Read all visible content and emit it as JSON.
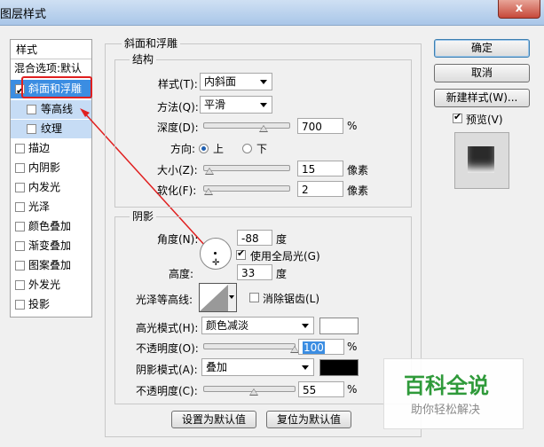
{
  "window": {
    "title": "图层样式",
    "close": "x"
  },
  "left_panel": {
    "header": "样式",
    "blend_options": "混合选项:默认",
    "items": [
      {
        "label": "斜面和浮雕",
        "checked": true,
        "selected": true
      },
      {
        "label": "等高线",
        "checked": false,
        "sub": true
      },
      {
        "label": "纹理",
        "checked": false,
        "sub": true
      },
      {
        "label": "描边",
        "checked": false
      },
      {
        "label": "内阴影",
        "checked": false
      },
      {
        "label": "内发光",
        "checked": false
      },
      {
        "label": "光泽",
        "checked": false
      },
      {
        "label": "颜色叠加",
        "checked": false
      },
      {
        "label": "渐变叠加",
        "checked": false
      },
      {
        "label": "图案叠加",
        "checked": false
      },
      {
        "label": "外发光",
        "checked": false
      },
      {
        "label": "投影",
        "checked": false
      }
    ]
  },
  "bevel": {
    "group_title": "斜面和浮雕",
    "structure_title": "结构",
    "style_label": "样式(T):",
    "style_value": "内斜面",
    "technique_label": "方法(Q):",
    "technique_value": "平滑",
    "depth_label": "深度(D):",
    "depth_value": "700",
    "depth_unit": "%",
    "depth_pct": 0.7,
    "direction_label": "方向:",
    "dir_up": "上",
    "dir_down": "下",
    "size_label": "大小(Z):",
    "size_value": "15",
    "size_unit": "像素",
    "size_pct": 0.06,
    "soften_label": "软化(F):",
    "soften_value": "2",
    "soften_unit": "像素",
    "soften_pct": 0.05
  },
  "shading": {
    "title": "阴影",
    "angle_label": "角度(N):",
    "angle_value": "-88",
    "angle_unit": "度",
    "global_light_label": "使用全局光(G)",
    "altitude_label": "高度:",
    "altitude_value": "33",
    "altitude_unit": "度",
    "gloss_label": "光泽等高线:",
    "antialias_label": "消除锯齿(L)",
    "highlight_label": "高光模式(H):",
    "highlight_value": "颜色减淡",
    "highlight_color": "#ffffff",
    "hl_opacity_label": "不透明度(O):",
    "hl_opacity_value": "100",
    "hl_opacity_unit": "%",
    "hl_opacity_pct": 1.0,
    "shadow_label": "阴影模式(A):",
    "shadow_value": "叠加",
    "shadow_color": "#000000",
    "sh_opacity_label": "不透明度(C):",
    "sh_opacity_value": "55",
    "sh_opacity_unit": "%",
    "sh_opacity_pct": 0.55
  },
  "bottom": {
    "set_default": "设置为默认值",
    "reset_default": "复位为默认值"
  },
  "right": {
    "ok": "确定",
    "cancel": "取消",
    "new_style": "新建样式(W)...",
    "preview": "预览(V)"
  },
  "watermark": {
    "main": "百科全说",
    "sub": "助你轻松解决"
  }
}
